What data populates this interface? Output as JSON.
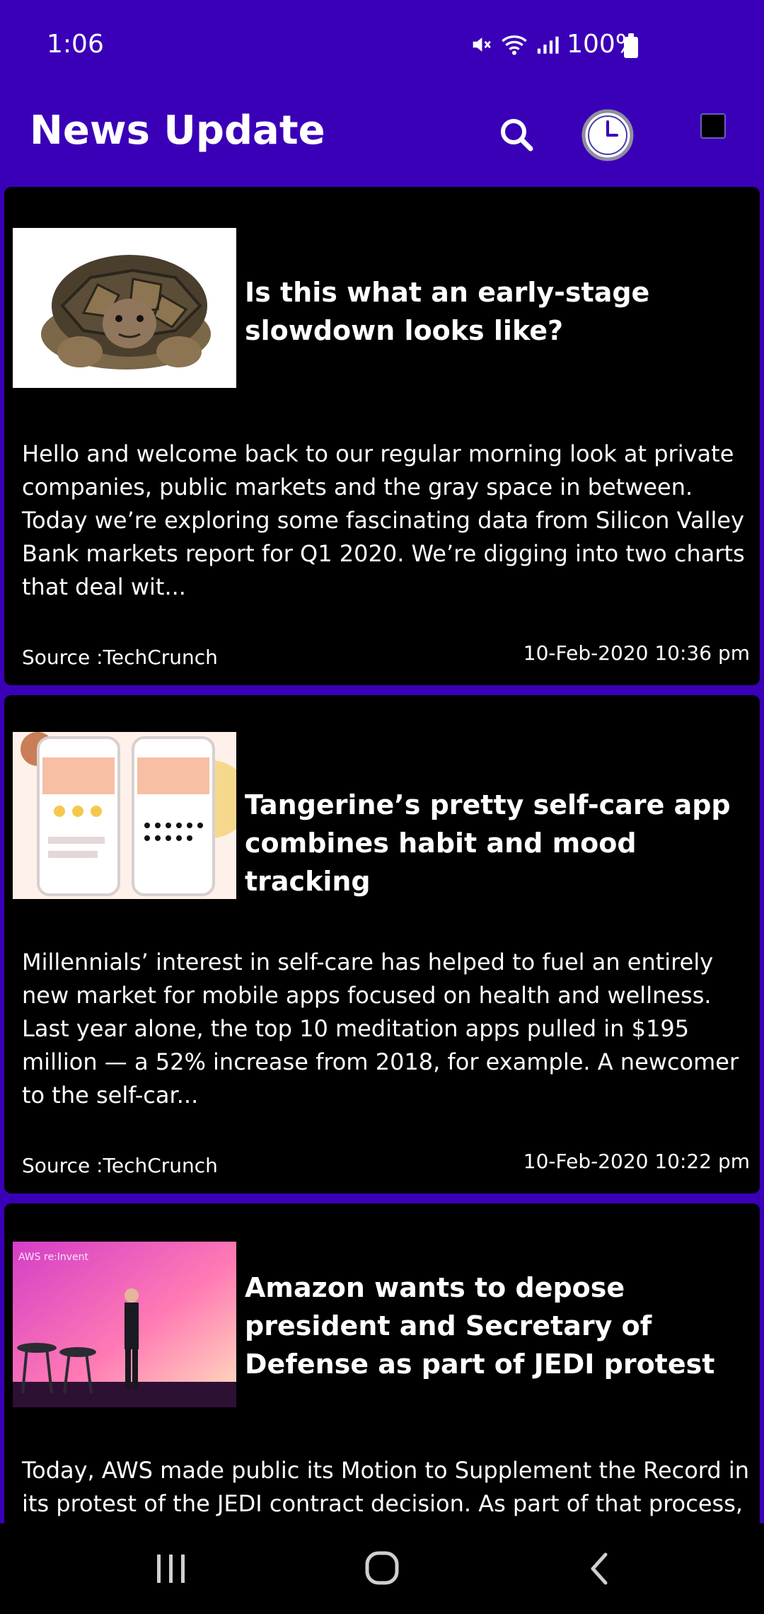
{
  "status_bar": {
    "time": "1:06",
    "battery": "100%"
  },
  "app_bar": {
    "title": "News Update"
  },
  "articles": [
    {
      "title": "Is this what an early-stage slowdown looks like?",
      "description": "Hello and welcome back to our regular morning look at private companies, public markets and the gray space in between. Today we’re exploring some fascinating data from Silicon Valley Bank markets report for Q1 2020. We’re digging into two charts that deal wit...",
      "source": "Source :TechCrunch",
      "date": "10-Feb-2020 10:36 pm"
    },
    {
      "title": "Tangerine’s pretty self-care app combines habit and mood tracking",
      "description": "Millennials’ interest in self-care has helped to fuel an entirely new market for mobile apps focused on health and wellness. Last year alone, the top 10 meditation apps pulled in $195 million — a 52% increase from 2018, for example. A newcomer to the self-car...",
      "source": "Source :TechCrunch",
      "date": "10-Feb-2020 10:22 pm"
    },
    {
      "title": "Amazon wants to depose president and Secretary of Defense as part of JEDI protest",
      "description": "Today, AWS made public its Motion to Supplement the Record in its protest of the JEDI contract decision. As part of that process,"
    }
  ],
  "article_3_image_text": "AWS re:Invent",
  "colors": {
    "primary": "#3a00b8",
    "card_background": "#000000",
    "text": "#ffffff"
  }
}
